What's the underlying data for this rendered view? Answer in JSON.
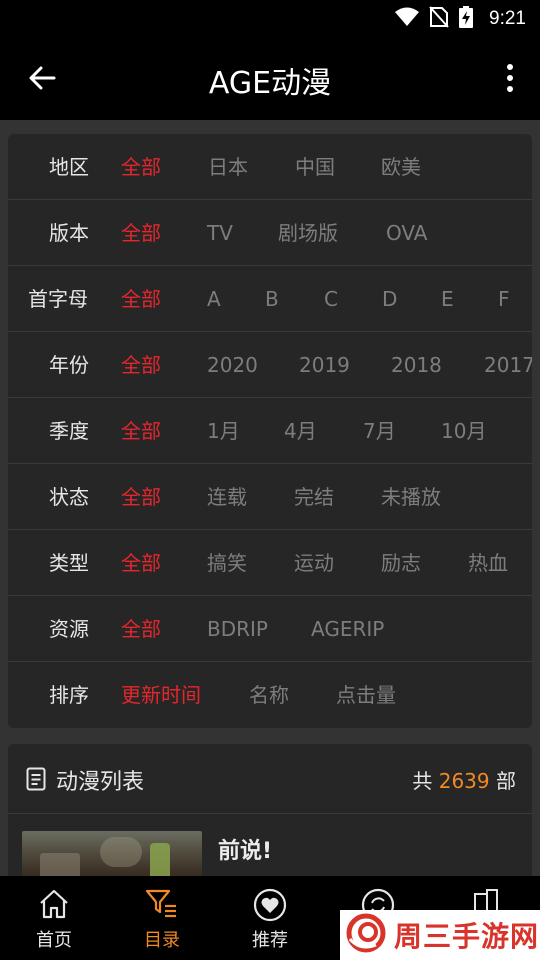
{
  "status_bar": {
    "time": "9:21"
  },
  "app_bar": {
    "title": "AGE动漫"
  },
  "filters": [
    {
      "label": "地区",
      "options": [
        "全部",
        "日本",
        "中国",
        "欧美"
      ],
      "active": "全部"
    },
    {
      "label": "版本",
      "options": [
        "全部",
        "TV",
        "剧场版",
        "OVA"
      ],
      "active": "全部"
    },
    {
      "label": "首字母",
      "options": [
        "全部",
        "A",
        "B",
        "C",
        "D",
        "E",
        "F"
      ],
      "active": "全部"
    },
    {
      "label": "年份",
      "options": [
        "全部",
        "2020",
        "2019",
        "2018",
        "2017"
      ],
      "active": "全部"
    },
    {
      "label": "季度",
      "options": [
        "全部",
        "1月",
        "4月",
        "7月",
        "10月"
      ],
      "active": "全部"
    },
    {
      "label": "状态",
      "options": [
        "全部",
        "连载",
        "完结",
        "未播放"
      ],
      "active": "全部"
    },
    {
      "label": "类型",
      "options": [
        "全部",
        "搞笑",
        "运动",
        "励志",
        "热血"
      ],
      "active": "全部"
    },
    {
      "label": "资源",
      "options": [
        "全部",
        "BDRIP",
        "AGERIP"
      ],
      "active": "全部"
    },
    {
      "label": "排序",
      "options": [
        "更新时间",
        "名称",
        "点击量"
      ],
      "active": "更新时间"
    }
  ],
  "anime_list": {
    "title": "动漫列表",
    "count_prefix": "共",
    "count": "2639",
    "count_suffix": "部",
    "items": [
      {
        "title": "前说!"
      }
    ]
  },
  "bottom_nav": {
    "items": [
      {
        "label": "首页",
        "icon": "home-icon"
      },
      {
        "label": "目录",
        "icon": "filter-list-icon",
        "active": true
      },
      {
        "label": "推荐",
        "icon": "heart-icon"
      },
      {
        "label": "",
        "icon": "refresh-icon"
      },
      {
        "label": "",
        "icon": "building-icon"
      }
    ]
  },
  "watermark": {
    "text": "周三手游网"
  },
  "colors": {
    "active_filter": "#e5262d",
    "accent": "#f08a24",
    "background": "#333333",
    "card": "#262626",
    "bar": "#000000"
  }
}
